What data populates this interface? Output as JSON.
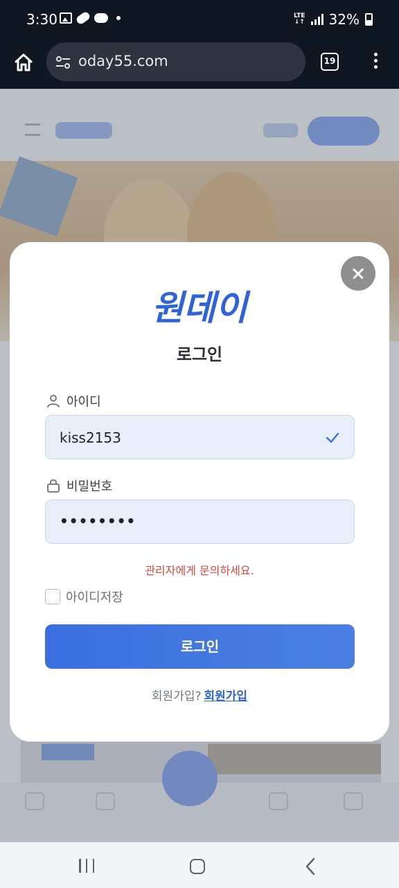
{
  "status_bar": {
    "time": "3:30",
    "network": "LTE",
    "battery": "32%"
  },
  "browser": {
    "url": "oday55.com",
    "tab_count": "19"
  },
  "modal": {
    "logo_text": "원데이",
    "title": "로그인",
    "id_label": "아이디",
    "id_value": "kiss2153",
    "password_label": "비밀번호",
    "password_value": "••••••••",
    "error_message": "관리자에게 문의하세요.",
    "remember_label": "아이디저장",
    "login_button": "로그인",
    "signup_prompt": "회원가입?",
    "signup_link": "회원가입"
  },
  "colors": {
    "accent": "#3b6fe0",
    "error": "#d2483f",
    "input_bg": "#e8effb"
  },
  "icons": [
    "home-icon",
    "tune-icon",
    "tabs-icon",
    "more-vert-icon",
    "close-icon",
    "user-icon",
    "lock-icon",
    "check-icon",
    "recent-apps-icon",
    "home-nav-icon",
    "back-icon"
  ]
}
